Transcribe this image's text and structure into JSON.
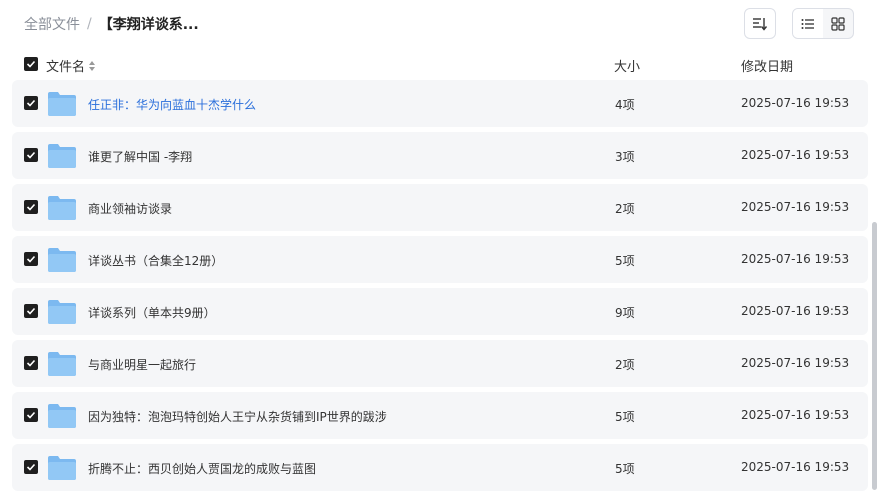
{
  "breadcrumb": {
    "root": "全部文件",
    "separator": "/",
    "current": "【李翔详谈系..."
  },
  "toolbar": {
    "sort_icon": "sort-icon",
    "list_view_icon": "list-view-icon",
    "grid_view_icon": "grid-view-icon"
  },
  "table": {
    "headers": {
      "name": "文件名",
      "size": "大小",
      "date": "修改日期"
    },
    "rows": [
      {
        "name": "任正非：华为向蓝血十杰学什么",
        "size": "4项",
        "date": "2025-07-16 19:53",
        "checked": true
      },
      {
        "name": "谁更了解中国 -李翔",
        "size": "3项",
        "date": "2025-07-16 19:53",
        "checked": true
      },
      {
        "name": "商业领袖访谈录",
        "size": "2项",
        "date": "2025-07-16 19:53",
        "checked": true
      },
      {
        "name": "详谈丛书（合集全12册）",
        "size": "5项",
        "date": "2025-07-16 19:53",
        "checked": true
      },
      {
        "name": "详谈系列（单本共9册）",
        "size": "9项",
        "date": "2025-07-16 19:53",
        "checked": true
      },
      {
        "name": "与商业明星一起旅行",
        "size": "2项",
        "date": "2025-07-16 19:53",
        "checked": true
      },
      {
        "name": "因为独特：泡泡玛特创始人王宁从杂货铺到IP世界的跋涉",
        "size": "5项",
        "date": "2025-07-16 19:53",
        "checked": true
      },
      {
        "name": "折腾不止：西贝创始人贾国龙的成败与蓝图",
        "size": "5项",
        "date": "2025-07-16 19:53",
        "checked": true
      }
    ]
  },
  "colors": {
    "row_bg": "#f5f6f8",
    "folder": "#7cb9f0",
    "link": "#2a6fdb"
  }
}
